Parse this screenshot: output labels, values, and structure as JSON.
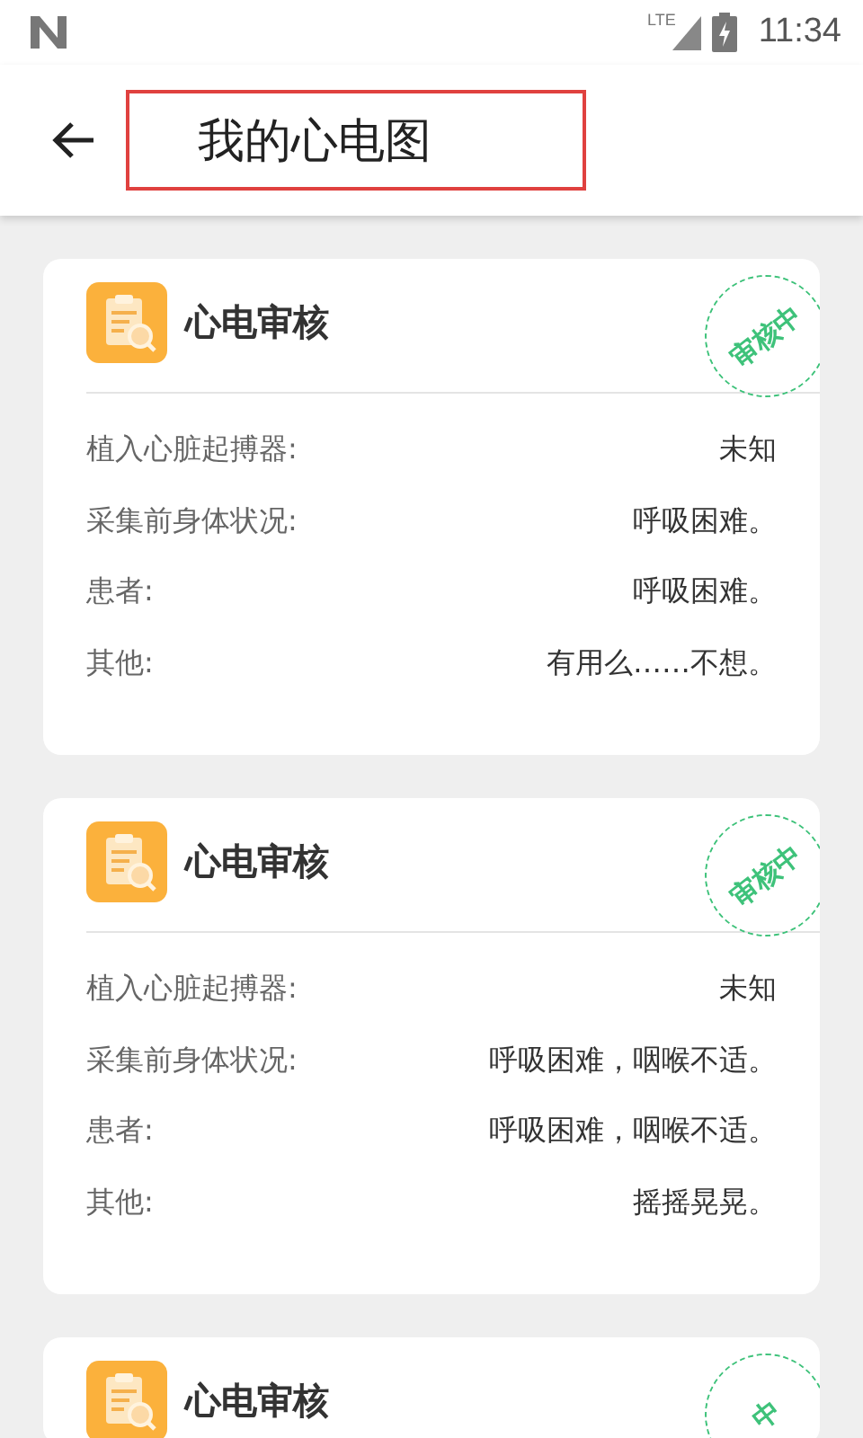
{
  "status_bar": {
    "network": "LTE",
    "time": "11:34"
  },
  "app_bar": {
    "title": "我的心电图",
    "title_highlighted": true
  },
  "cards": [
    {
      "title": "心电审核",
      "stamp": "审核中",
      "rows": [
        {
          "label": "植入心脏起搏器:",
          "value": "未知"
        },
        {
          "label": "采集前身体状况:",
          "value": "呼吸困难。"
        },
        {
          "label": "患者:",
          "value": "呼吸困难。"
        },
        {
          "label": "其他:",
          "value": "有用么……不想。"
        }
      ]
    },
    {
      "title": "心电审核",
      "stamp": "审核中",
      "rows": [
        {
          "label": "植入心脏起搏器:",
          "value": "未知"
        },
        {
          "label": "采集前身体状况:",
          "value": "呼吸困难，咽喉不适。"
        },
        {
          "label": "患者:",
          "value": "呼吸困难，咽喉不适。"
        },
        {
          "label": "其他:",
          "value": "摇摇晃晃。"
        }
      ]
    },
    {
      "title": "心电审核",
      "stamp": "中"
    }
  ]
}
